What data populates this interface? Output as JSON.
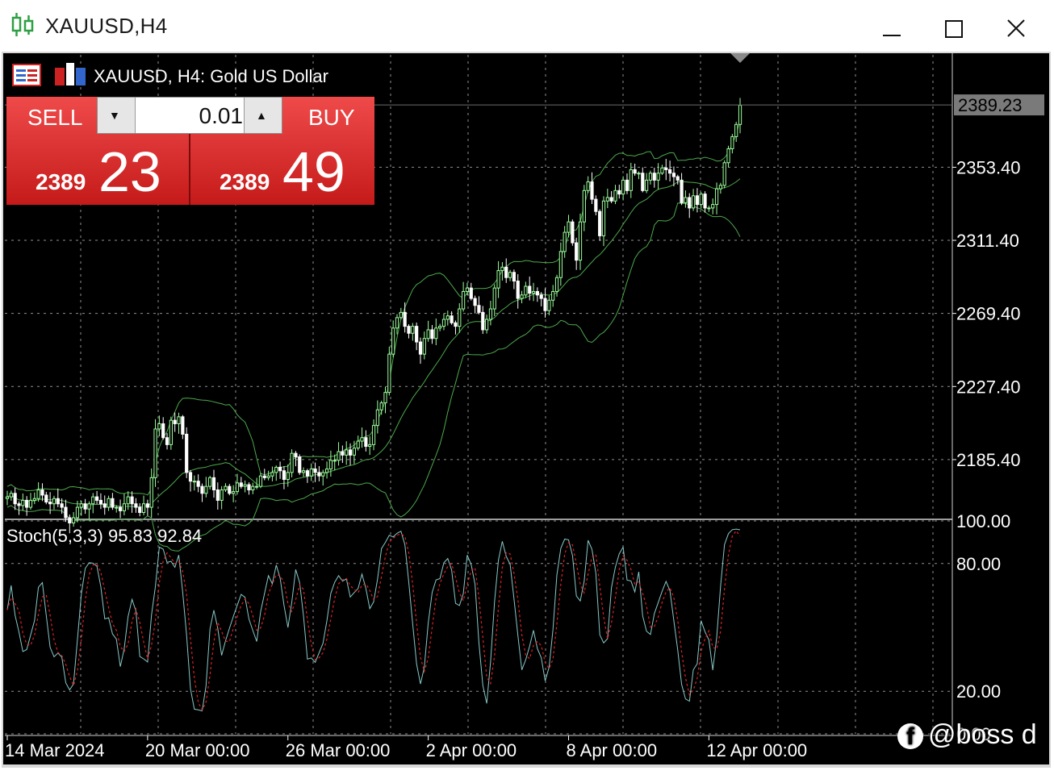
{
  "window": {
    "title": "XAUUSD,H4",
    "controls": {
      "minimize": "minimize-icon",
      "maximize": "maximize-icon",
      "close": "close-icon"
    }
  },
  "chart_header": {
    "description": "XAUUSD, H4:  Gold US Dollar",
    "icons": [
      "one-click-trading-icon",
      "symbol-properties-icon"
    ]
  },
  "trade_panel": {
    "sell_label": "SELL",
    "buy_label": "BUY",
    "volume": "0.01",
    "sell_price_prefix": "2389",
    "sell_price_big": "23",
    "buy_price_prefix": "2389",
    "buy_price_big": "49"
  },
  "colors": {
    "background": "#000000",
    "grid": "#c0c0c0",
    "bull_candle": "#9cff9c",
    "bear_candle": "#ffffff",
    "bollinger": "#4caa4c",
    "stoch_main": "#88c8c8",
    "stoch_signal": "#dd2222",
    "price_line": "#6e6e6e",
    "panel_red": "#d42222"
  },
  "chart_data": [
    {
      "type": "candlestick",
      "title": "XAUUSD, H4:  Gold US Dollar",
      "indicators": [
        "Bollinger Bands"
      ],
      "y_ticks": [
        "2353.40",
        "2311.40",
        "2269.40",
        "2227.40",
        "2185.40"
      ],
      "current_price_label": "2389.23",
      "current_price": 2389.23,
      "ylim": [
        2152,
        2418
      ],
      "x_ticks": [
        "14 Mar 2024",
        "20 Mar 00:00",
        "26 Mar 00:00",
        "2 Apr 00:00",
        "8 Apr 00:00",
        "12 Apr 00:00"
      ],
      "x_tick_index": [
        0,
        36,
        72,
        108,
        144,
        180
      ],
      "closes": [
        2164,
        2166,
        2160,
        2159,
        2162,
        2158,
        2162,
        2163,
        2168,
        2165,
        2161,
        2160,
        2163,
        2160,
        2158,
        2152,
        2149,
        2152,
        2158,
        2160,
        2157,
        2160,
        2164,
        2162,
        2160,
        2158,
        2163,
        2158,
        2158,
        2156,
        2160,
        2164,
        2160,
        2158,
        2155,
        2160,
        2158,
        2175,
        2203,
        2206,
        2198,
        2194,
        2208,
        2206,
        2210,
        2200,
        2178,
        2173,
        2173,
        2170,
        2166,
        2170,
        2175,
        2168,
        2162,
        2168,
        2170,
        2166,
        2167,
        2172,
        2170,
        2171,
        2168,
        2170,
        2170,
        2176,
        2175,
        2176,
        2178,
        2181,
        2179,
        2174,
        2178,
        2189,
        2187,
        2178,
        2179,
        2176,
        2180,
        2178,
        2176,
        2178,
        2180,
        2185,
        2185,
        2190,
        2188,
        2191,
        2188,
        2192,
        2196,
        2198,
        2193,
        2194,
        2205,
        2214,
        2218,
        2224,
        2246,
        2261,
        2267,
        2270,
        2262,
        2258,
        2262,
        2253,
        2246,
        2255,
        2260,
        2255,
        2261,
        2262,
        2266,
        2268,
        2264,
        2262,
        2272,
        2282,
        2284,
        2278,
        2274,
        2270,
        2260,
        2266,
        2272,
        2284,
        2294,
        2296,
        2290,
        2293,
        2288,
        2278,
        2280,
        2285,
        2281,
        2282,
        2280,
        2278,
        2271,
        2277,
        2282,
        2290,
        2305,
        2316,
        2322,
        2310,
        2300,
        2322,
        2340,
        2345,
        2335,
        2328,
        2314,
        2334,
        2336,
        2334,
        2340,
        2338,
        2346,
        2340,
        2352,
        2350,
        2350,
        2340,
        2346,
        2350,
        2346,
        2350,
        2353,
        2352,
        2350,
        2348,
        2346,
        2333,
        2336,
        2330,
        2337,
        2332,
        2338,
        2330,
        2330,
        2332,
        2341,
        2343,
        2356,
        2364,
        2371,
        2378,
        2389
      ],
      "candle_count": 190
    },
    {
      "type": "line",
      "title": "Stoch(5,3,3) 95.83 92.84",
      "series": [
        {
          "name": "main",
          "last_value": 95.83
        },
        {
          "name": "signal",
          "last_value": 92.84
        }
      ],
      "y_ticks": [
        "100.00",
        "80.00",
        "20.00",
        "0.00"
      ],
      "ylim": [
        0,
        100
      ]
    }
  ],
  "watermark": {
    "text": "@boss d",
    "icon": "facebook-icon"
  }
}
